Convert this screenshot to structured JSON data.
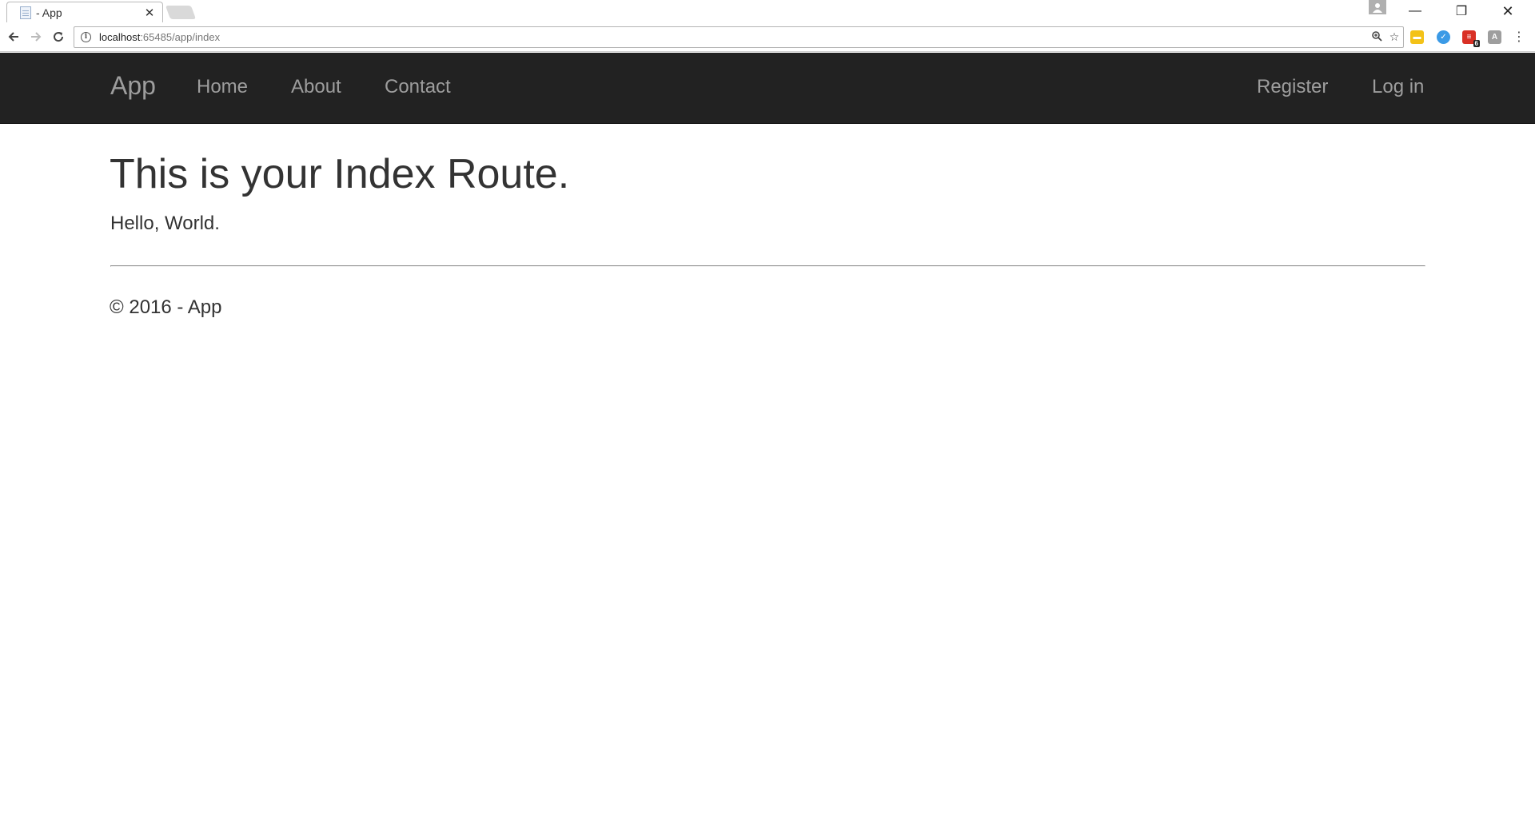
{
  "browser": {
    "tab_title": "- App",
    "tab_close": "✕",
    "url_host": "localhost",
    "url_rest": ":65485/app/index",
    "extension_badge": "6",
    "window_controls": {
      "minimize": "—",
      "maximize": "❐",
      "close": "✕"
    },
    "icons": [
      "back-arrow-icon",
      "forward-arrow-icon",
      "reload-icon",
      "info-icon",
      "zoom-icon",
      "star-icon",
      "menu-icon"
    ]
  },
  "navbar": {
    "brand": "App",
    "left_links": [
      "Home",
      "About",
      "Contact"
    ],
    "right_links": [
      "Register",
      "Log in"
    ],
    "background": "#222222",
    "link_color": "#9d9d9d"
  },
  "main": {
    "heading": "This is your Index Route.",
    "text": "Hello, World."
  },
  "footer": {
    "text": "© 2016 - App"
  }
}
